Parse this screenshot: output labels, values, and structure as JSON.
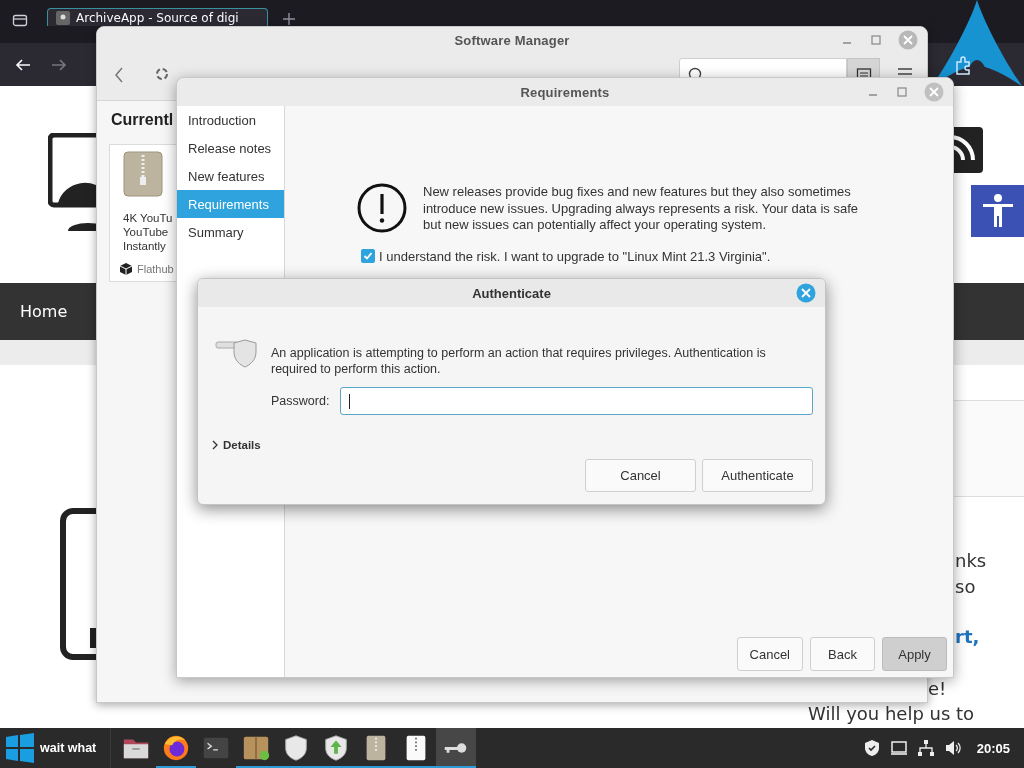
{
  "browser": {
    "tab_title": "ArchiveApp - Source of digi",
    "nav_items": [
      "Home"
    ],
    "page_texts": [
      {
        "text": "nks",
        "kind": "plain"
      },
      {
        "text": "so",
        "kind": "plain"
      },
      {
        "text": "rt,",
        "kind": "link"
      },
      {
        "text": "e!",
        "kind": "plain"
      },
      {
        "text": "Will you help us to",
        "kind": "plain"
      }
    ]
  },
  "software_manager": {
    "title": "Software Manager",
    "heading": "Currentl",
    "app_card": {
      "name_lines": [
        "4K YouTu",
        "YouTube",
        "Instantly"
      ],
      "source": "Flathub"
    }
  },
  "upgrade_window": {
    "title": "Requirements",
    "steps": [
      {
        "label": "Introduction",
        "selected": false
      },
      {
        "label": "Release notes",
        "selected": false
      },
      {
        "label": "New features",
        "selected": false
      },
      {
        "label": "Requirements",
        "selected": true
      },
      {
        "label": "Summary",
        "selected": false
      }
    ],
    "message": "New releases provide bug fixes and new features but they also sometimes introduce new issues. Upgrading always represents a risk. Your data is safe but new issues can potentially affect your operating system.",
    "agree": {
      "label": "I understand the risk. I want to upgrade to \"Linux Mint 21.3 Virginia\".",
      "checked": true
    },
    "buttons": [
      {
        "label": "Cancel",
        "pressed": false
      },
      {
        "label": "Back",
        "pressed": false
      },
      {
        "label": "Apply",
        "pressed": true
      }
    ]
  },
  "auth_dialog": {
    "title": "Authenticate",
    "message": "An application is attempting to perform an action that requires privileges. Authentication is required to perform this action.",
    "password_label": "Password:",
    "details": {
      "label": "Details",
      "expanded": false
    },
    "buttons": [
      "Cancel",
      "Authenticate"
    ]
  },
  "taskbar": {
    "start_label": "wait what",
    "apps": [
      {
        "kind": "folder",
        "running": false,
        "active": false
      },
      {
        "kind": "browser",
        "running": true,
        "active": false
      },
      {
        "kind": "terminal",
        "running": false,
        "active": false
      },
      {
        "kind": "package",
        "running": true,
        "active": false
      },
      {
        "kind": "shield",
        "running": true,
        "active": false
      },
      {
        "kind": "update",
        "running": true,
        "active": false
      },
      {
        "kind": "archive",
        "running": true,
        "active": false
      },
      {
        "kind": "zip",
        "running": true,
        "active": false
      },
      {
        "kind": "key",
        "running": true,
        "active": true
      }
    ],
    "clock": "20:05"
  }
}
